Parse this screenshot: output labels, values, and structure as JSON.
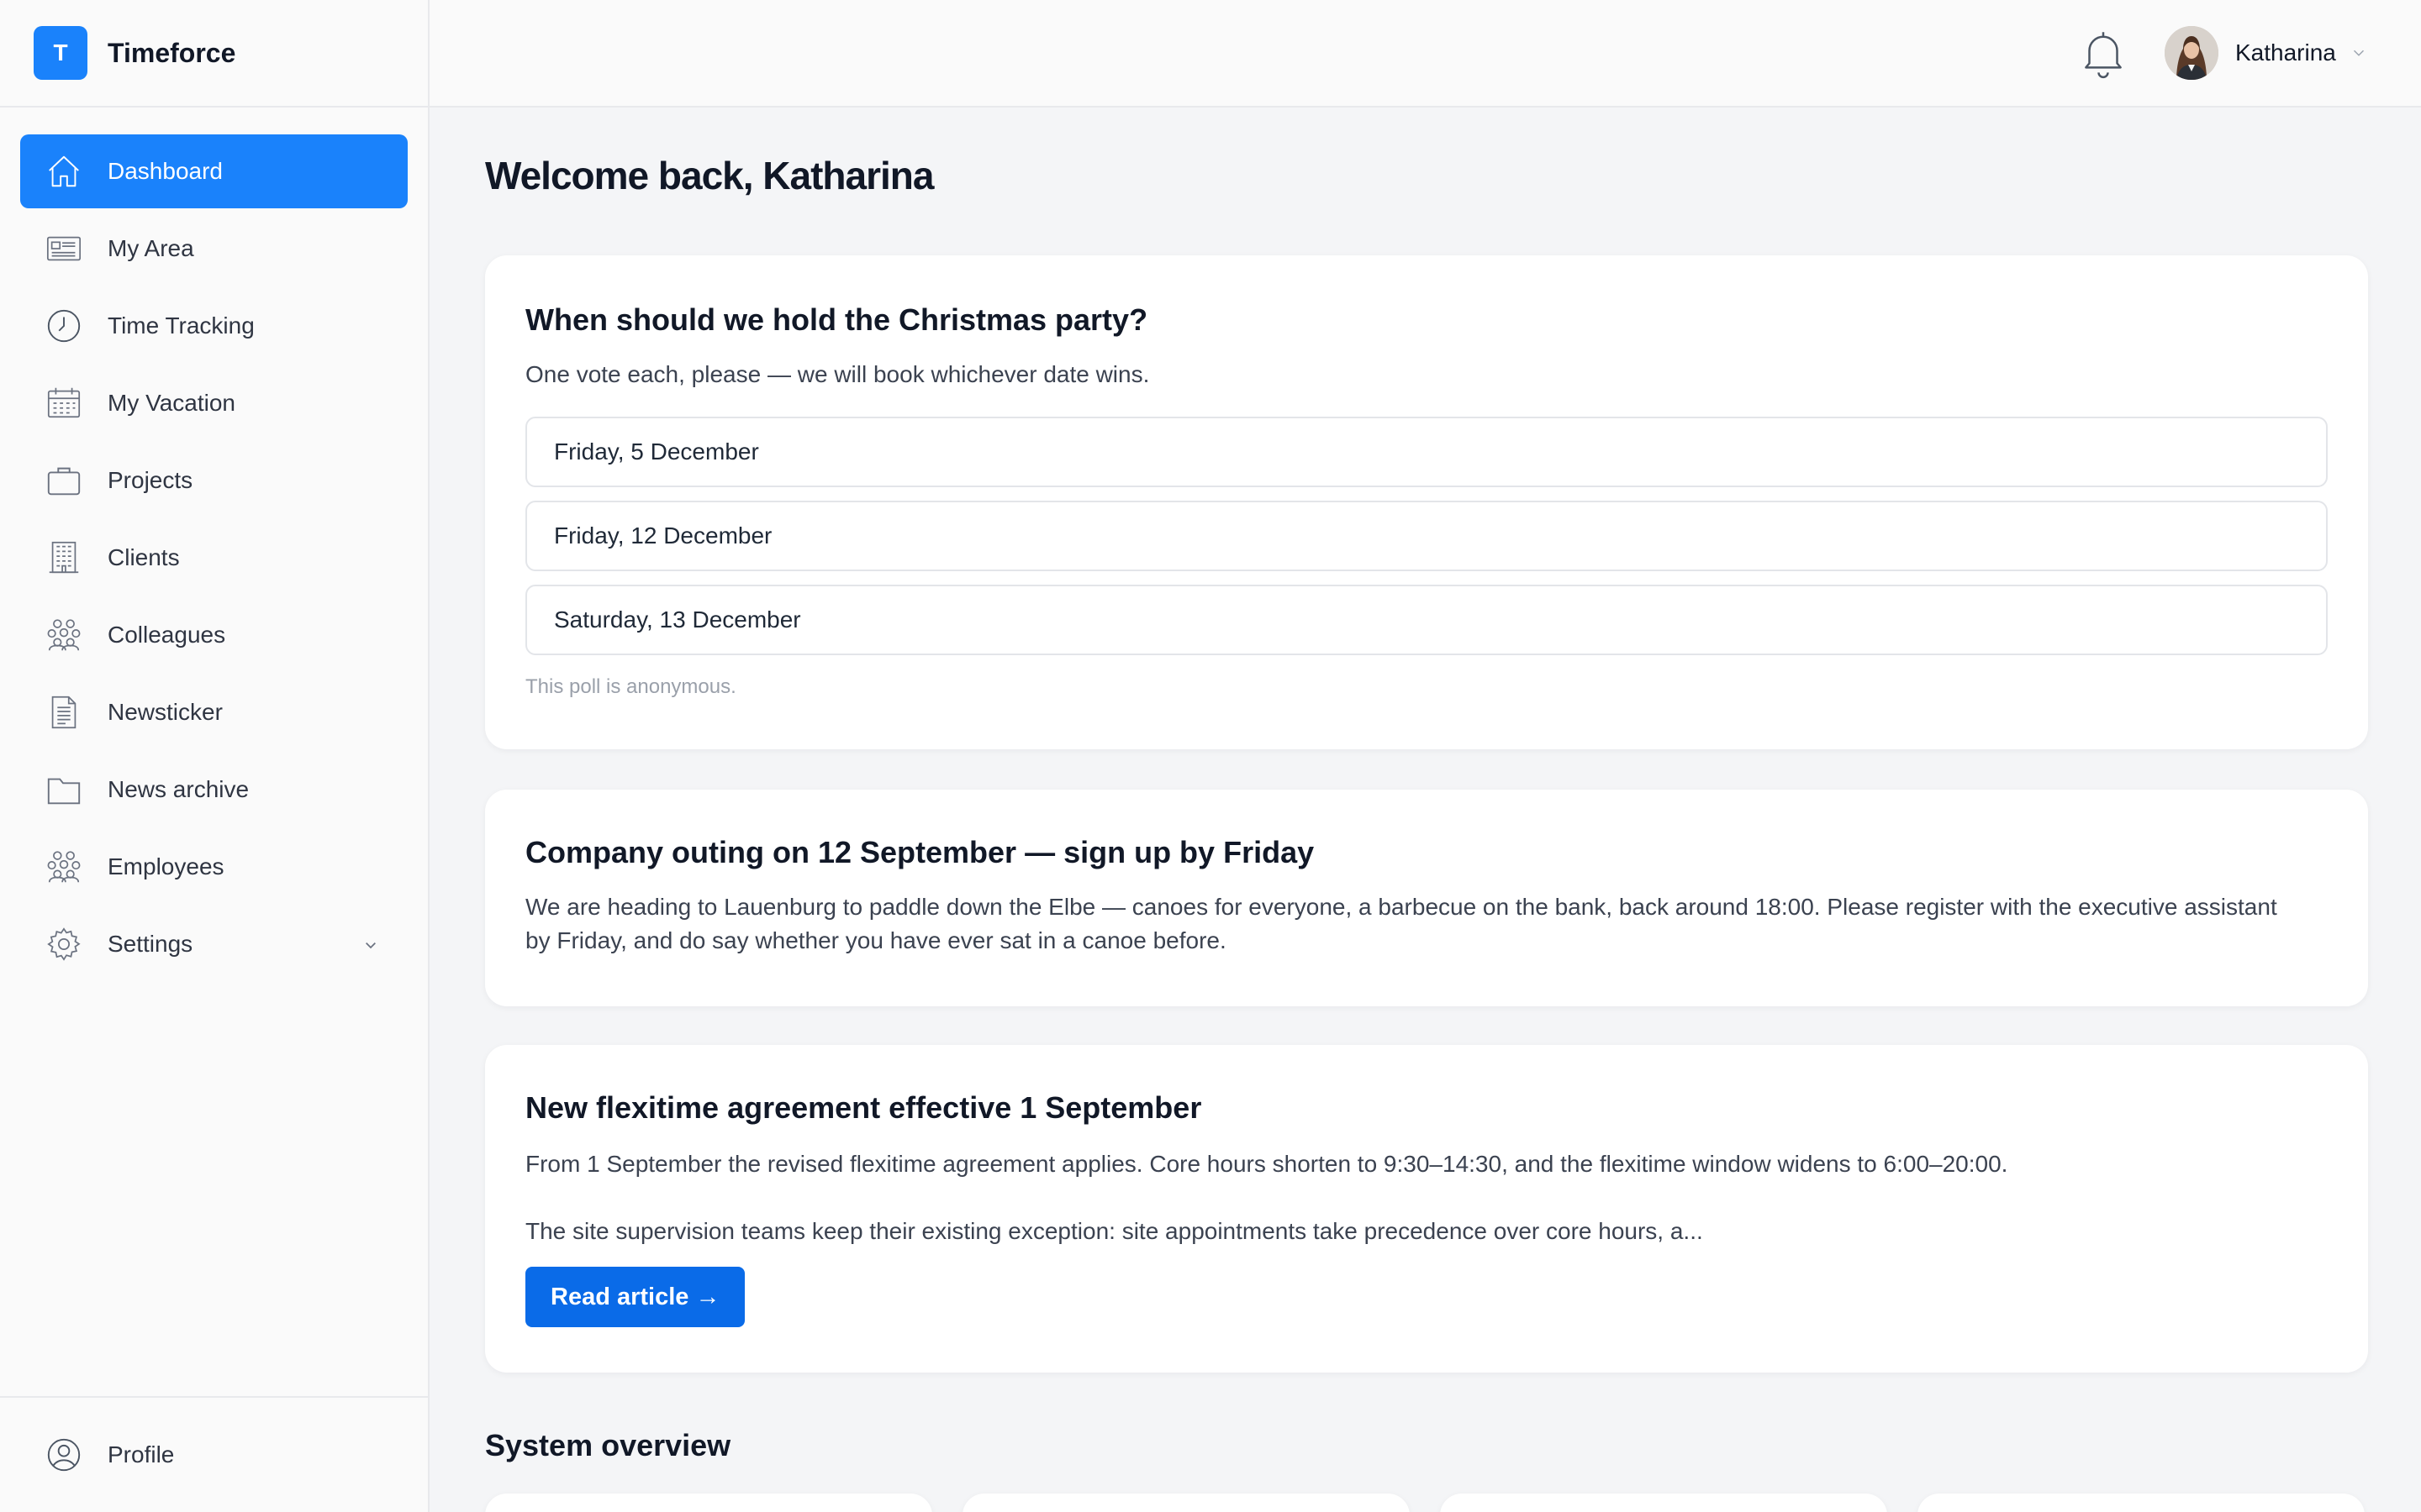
{
  "app": {
    "logo_letter": "T",
    "name": "Timeforce"
  },
  "sidebar": {
    "items": [
      {
        "label": "Dashboard",
        "icon": "home-icon",
        "active": true
      },
      {
        "label": "My Area",
        "icon": "id-card-icon"
      },
      {
        "label": "Time Tracking",
        "icon": "clock-icon"
      },
      {
        "label": "My Vacation",
        "icon": "calendar-icon"
      },
      {
        "label": "Projects",
        "icon": "briefcase-icon"
      },
      {
        "label": "Clients",
        "icon": "building-icon"
      },
      {
        "label": "Colleagues",
        "icon": "people-group-icon"
      },
      {
        "label": "Newsticker",
        "icon": "document-icon"
      },
      {
        "label": "News archive",
        "icon": "folder-icon"
      },
      {
        "label": "Employees",
        "icon": "people-group-icon"
      },
      {
        "label": "Settings",
        "icon": "gear-icon",
        "has_submenu": true
      }
    ],
    "bottom": {
      "label": "Profile",
      "icon": "user-circle-icon"
    }
  },
  "topbar": {
    "user_name": "Katharina",
    "bell_icon": "bell-icon"
  },
  "main": {
    "welcome": "Welcome back, Katharina",
    "poll": {
      "title": "When should we hold the Christmas party?",
      "subtitle": "One vote each, please — we will book whichever date wins.",
      "options": [
        "Friday, 5 December",
        "Friday, 12 December",
        "Saturday, 13 December"
      ],
      "note": "This poll is anonymous."
    },
    "outing": {
      "title": "Company outing on 12 September — sign up by Friday",
      "body": "We are heading to Lauenburg to paddle down the Elbe — canoes for everyone, a barbecue on the bank, back around 18:00. Please register with the executive assistant by Friday, and do say whether you have ever sat in a canoe before."
    },
    "flexitime": {
      "title": "New flexitime agreement effective 1 September",
      "para1": "From 1 September the revised flexitime agreement applies. Core hours shorten to 9:30–14:30, and the flexitime window widens to 6:00–20:00.",
      "para2": "The site supervision teams keep their existing exception: site appointments take precedence over core hours, a...",
      "button": "Read article →"
    },
    "system_overview": "System overview"
  },
  "colors": {
    "accent": "#1a82fb",
    "button": "#0a6be8",
    "background": "#f4f5f7"
  }
}
